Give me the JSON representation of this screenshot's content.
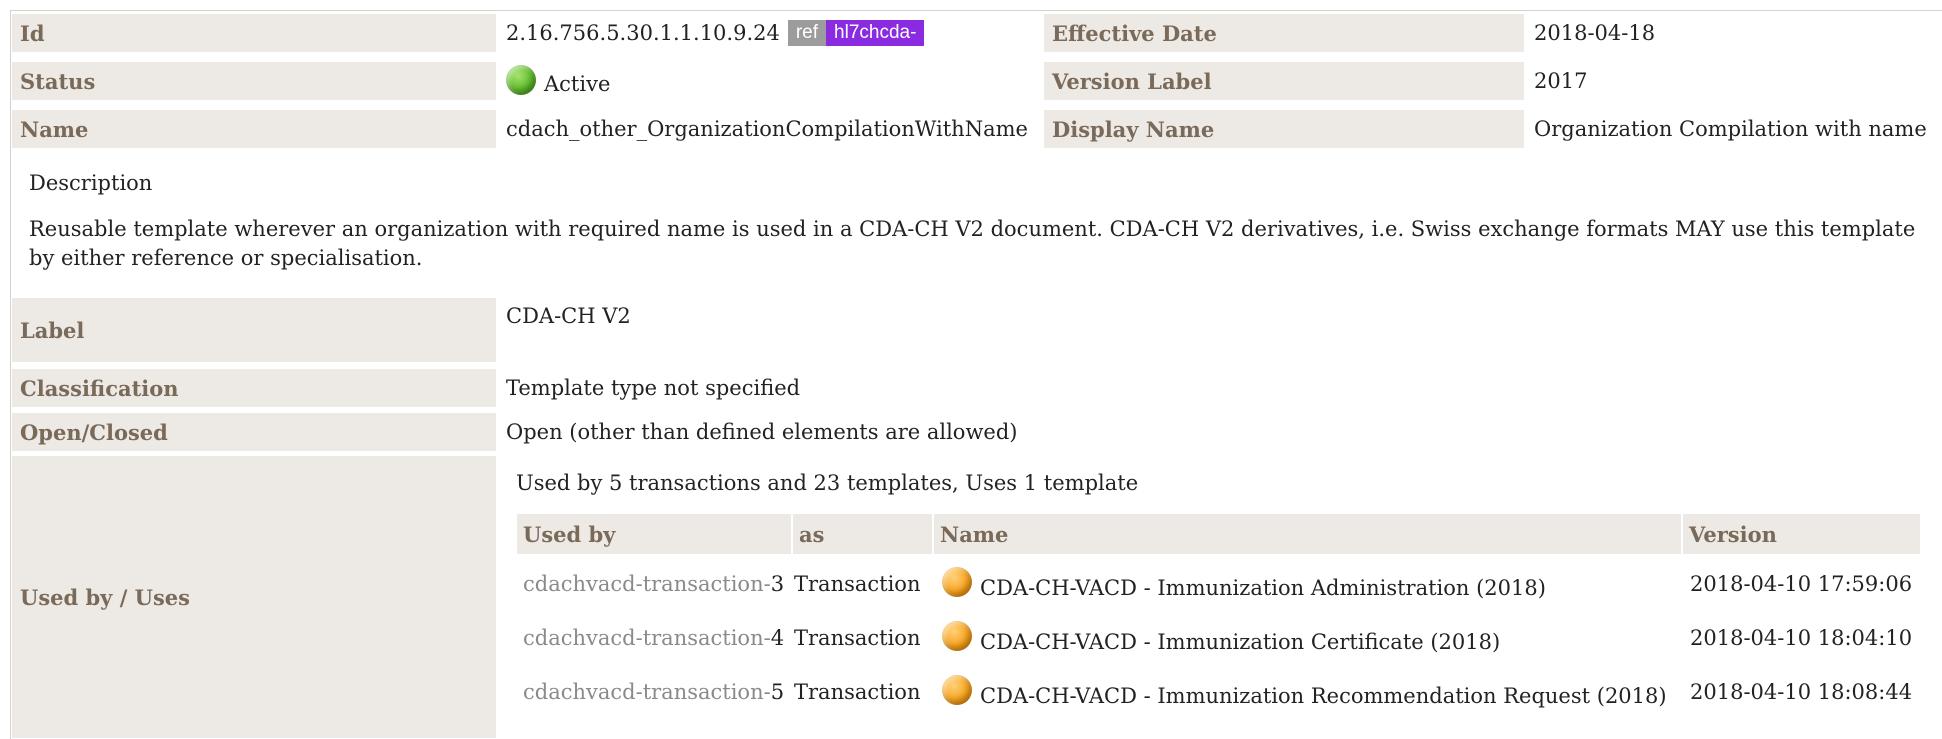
{
  "header": {
    "id_label": "Id",
    "id_value": "2.16.756.5.30.1.1.10.9.24",
    "ref_badge": "ref",
    "prefix_badge": "hl7chcda-",
    "effective_date_label": "Effective Date",
    "effective_date_value": "2018-04-18",
    "status_label": "Status",
    "status_value": "Active",
    "version_label_label": "Version Label",
    "version_label_value": "2017",
    "name_label": "Name",
    "name_value": "cdach_other_OrganizationCompilationWithName",
    "display_name_label": "Display Name",
    "display_name_value": "Organization Compilation with name"
  },
  "description": {
    "heading": "Description",
    "text": "Reusable template wherever an organization with required name is used in a CDA-CH V2 document. CDA-CH V2 derivatives, i.e. Swiss exchange formats MAY use this template by either reference or specialisation."
  },
  "details": {
    "label_label": "Label",
    "label_value": "CDA-CH V2",
    "classification_label": "Classification",
    "classification_value": "Template type not specified",
    "open_closed_label": "Open/Closed",
    "open_closed_value": "Open (other than defined elements are allowed)",
    "used_by_label": "Used by / Uses"
  },
  "usage": {
    "summary": "Used by 5 transactions and 23 templates, Uses 1 template",
    "columns": [
      "Used by",
      "as",
      "Name",
      "Version"
    ],
    "rows": [
      {
        "ref_prefix": "cdachvacd-transaction-",
        "ref_num": "3",
        "as": "Transaction",
        "name": "CDA-CH-VACD - Immunization Administration (2018)",
        "version": "2018-04-10 17:59:06",
        "status_color": "#f7a21b"
      },
      {
        "ref_prefix": "cdachvacd-transaction-",
        "ref_num": "4",
        "as": "Transaction",
        "name": "CDA-CH-VACD - Immunization Certificate (2018)",
        "version": "2018-04-10 18:04:10",
        "status_color": "#f7a21b"
      },
      {
        "ref_prefix": "cdachvacd-transaction-",
        "ref_num": "5",
        "as": "Transaction",
        "name": "CDA-CH-VACD - Immunization Recommendation Request (2018)",
        "version": "2018-04-10 18:08:44",
        "status_color": "#f7a21b"
      }
    ]
  },
  "colors": {
    "label_bg": "#ede9e4",
    "label_text": "#7a6a5a",
    "ref_badge_bg": "#9c9c9c",
    "prefix_badge_bg": "#8a2be2",
    "active_status": "#5cb82a",
    "pending_status": "#f7a21b"
  }
}
